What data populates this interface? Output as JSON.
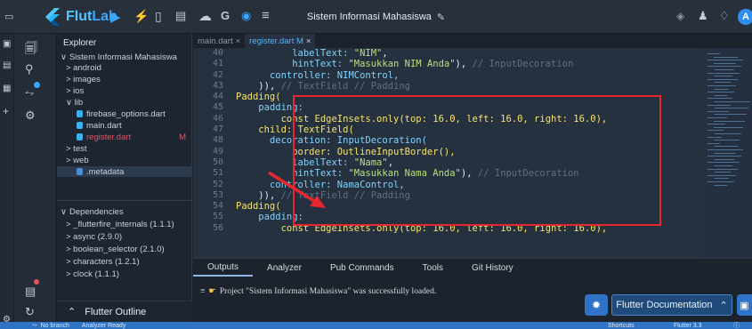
{
  "app": {
    "brand_prefix": "Flut",
    "brand_suffix": "Lab",
    "project_title": "Sistem Informasi Mahasiswa",
    "avatar_letter": "A"
  },
  "explorer": {
    "heading": "Explorer",
    "project_root": "Sistem Informasi Mahasiswa",
    "items": [
      {
        "label": "> android"
      },
      {
        "label": "> images"
      },
      {
        "label": "> ios"
      },
      {
        "label": "∨ lib"
      },
      {
        "label": "firebase_options.dart"
      },
      {
        "label": "main.dart"
      },
      {
        "label": "register.dart",
        "badge": "M"
      },
      {
        "label": "> test"
      },
      {
        "label": "> web"
      },
      {
        "label": ".metadata"
      }
    ],
    "dependencies_heading": "Dependencies",
    "dependencies": [
      "> _flutterfire_internals (1.1.1)",
      "> async (2.9.0)",
      "> boolean_selector (2.1.0)",
      "> characters (1.2.1)",
      "> clock (1.1.1)"
    ],
    "outline_label": "Flutter Outline"
  },
  "editor": {
    "tabs": [
      {
        "label": "main.dart"
      },
      {
        "label": "register.dart M"
      }
    ],
    "line_numbers": [
      "40",
      "41",
      "42",
      "43",
      "44",
      "45",
      "46",
      "47",
      "48",
      "49",
      "50",
      "51",
      "52",
      "53",
      "54",
      "55",
      "56"
    ],
    "lines": [
      {
        "indent": "          ",
        "parts": [
          {
            "t": "labelText: ",
            "c": "pr"
          },
          {
            "t": "\"NIM\"",
            "c": "st"
          },
          {
            "t": ",",
            "c": ""
          }
        ]
      },
      {
        "indent": "          ",
        "parts": [
          {
            "t": "hintText: ",
            "c": "pr"
          },
          {
            "t": "\"Masukkan NIM Anda\"",
            "c": "st"
          },
          {
            "t": "), ",
            "c": ""
          },
          {
            "t": "// InputDecoration",
            "c": "cm"
          }
        ]
      },
      {
        "indent": "      ",
        "parts": [
          {
            "t": "controller: NIMControl,",
            "c": "pr"
          }
        ]
      },
      {
        "indent": "    ",
        "parts": [
          {
            "t": ")), ",
            "c": ""
          },
          {
            "t": "// TextField // Padding",
            "c": "cm"
          }
        ]
      },
      {
        "indent": "",
        "parts": [
          {
            "t": "Padding(",
            "c": "kw"
          }
        ]
      },
      {
        "indent": "    ",
        "parts": [
          {
            "t": "padding:",
            "c": "pr"
          }
        ]
      },
      {
        "indent": "        ",
        "parts": [
          {
            "t": "const EdgeInsets.only(top: 16.0, left: 16.0, right: 16.0),",
            "c": "kw"
          }
        ]
      },
      {
        "indent": "    ",
        "parts": [
          {
            "t": "child: TextField(",
            "c": "kw"
          }
        ]
      },
      {
        "indent": "      ",
        "parts": [
          {
            "t": "decoration: InputDecoration(",
            "c": "pr"
          }
        ]
      },
      {
        "indent": "          ",
        "parts": [
          {
            "t": "border: OutlineInputBorder(),",
            "c": "kw"
          }
        ]
      },
      {
        "indent": "          ",
        "parts": [
          {
            "t": "labelText: ",
            "c": "pr"
          },
          {
            "t": "\"Nama\"",
            "c": "st"
          },
          {
            "t": ",",
            "c": ""
          }
        ]
      },
      {
        "indent": "          ",
        "parts": [
          {
            "t": "hintText: ",
            "c": "pr"
          },
          {
            "t": "\"Masukkan Nama Anda\"",
            "c": "st"
          },
          {
            "t": "), ",
            "c": ""
          },
          {
            "t": "// InputDecoration",
            "c": "cm"
          }
        ]
      },
      {
        "indent": "      ",
        "parts": [
          {
            "t": "controller: NamaControl,",
            "c": "pr"
          }
        ]
      },
      {
        "indent": "    ",
        "parts": [
          {
            "t": ")), ",
            "c": ""
          },
          {
            "t": "// TextField // Padding",
            "c": "cm"
          }
        ]
      },
      {
        "indent": "",
        "parts": [
          {
            "t": "Padding(",
            "c": "kw"
          }
        ]
      },
      {
        "indent": "    ",
        "parts": [
          {
            "t": "padding:",
            "c": "pr"
          }
        ]
      },
      {
        "indent": "        ",
        "parts": [
          {
            "t": "const EdgeInsets.only(top: 16.0, left: 16.0, right: 16.0),",
            "c": "kw"
          }
        ]
      }
    ]
  },
  "bottom_panel": {
    "tabs": [
      "Outputs",
      "Analyzer",
      "Pub Commands",
      "Tools",
      "Git History"
    ],
    "message": "Project \"Sistem Informasi Mahasiswa\" was successfully loaded.",
    "doc_button": "Flutter Documentation"
  },
  "status_bar": {
    "branch": "No branch",
    "analyzer": "Analyzer Ready",
    "shortcuts": "Shortcuts",
    "flutter_version": "Flutter 3.3"
  },
  "colors": {
    "annotation_red": "#e8262f",
    "accent_blue": "#3aa8ff"
  }
}
